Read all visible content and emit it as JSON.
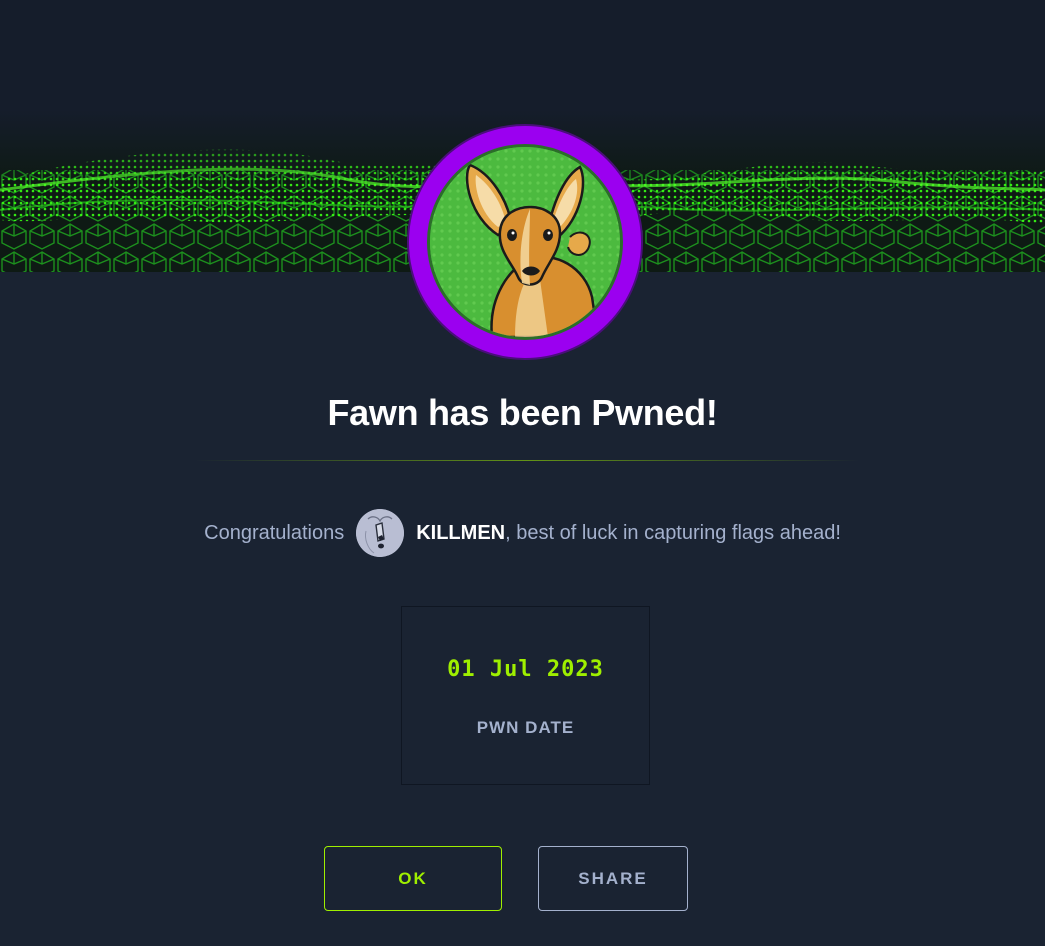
{
  "machine": {
    "name": "Fawn",
    "title": "Fawn has been Pwned!"
  },
  "congrats": {
    "prefix": "Congratulations",
    "username": "KILLMEN",
    "suffix": ", best of luck in capturing flags ahead!"
  },
  "pwn": {
    "date": "01 Jul 2023",
    "label": "PWN DATE"
  },
  "buttons": {
    "ok": "OK",
    "share": "SHARE"
  },
  "colors": {
    "background": "#1a2332",
    "accent_green": "#9fef00",
    "muted_text": "#a4b1cd",
    "avatar_ring": "#9b00f0"
  },
  "icons": {
    "machine_avatar": "fawn-deer-icon",
    "user_avatar": "polar-bear-icon"
  }
}
